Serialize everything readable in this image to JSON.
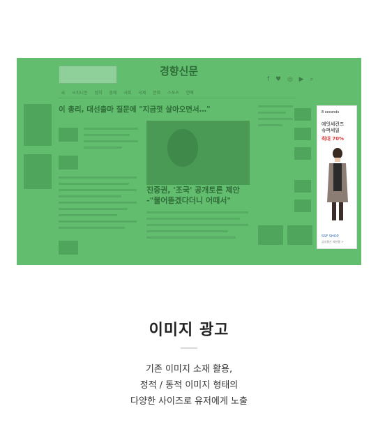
{
  "preview": {
    "masthead": "경향신문",
    "headline": "이 총리, 대선출마 질문에 \"지금껏 살아오면서…\"",
    "sub_headline": "진중권, '조국' 공개토론 제안 -\"물어뜯겠다더니 어때서\"",
    "nav_items": [
      "오피니언",
      "정치",
      "경제",
      "사회",
      "국제",
      "문화",
      "스포츠",
      "연예"
    ],
    "colors": {
      "overlay": "#62be6e"
    },
    "ad": {
      "brand": "8 seconds",
      "title_line1": "에잇세컨즈",
      "title_line2": "슈퍼세일",
      "discount": "최대 70%",
      "shop": "SSF SHOP",
      "shop_sub": "삼성물산 패션몰 >"
    }
  },
  "title": "이미지 광고",
  "description": [
    "기존 이미지 소재 활용,",
    "정적 / 동적 이미지 형태의",
    "다양한 사이즈로 유저에게 노출"
  ]
}
